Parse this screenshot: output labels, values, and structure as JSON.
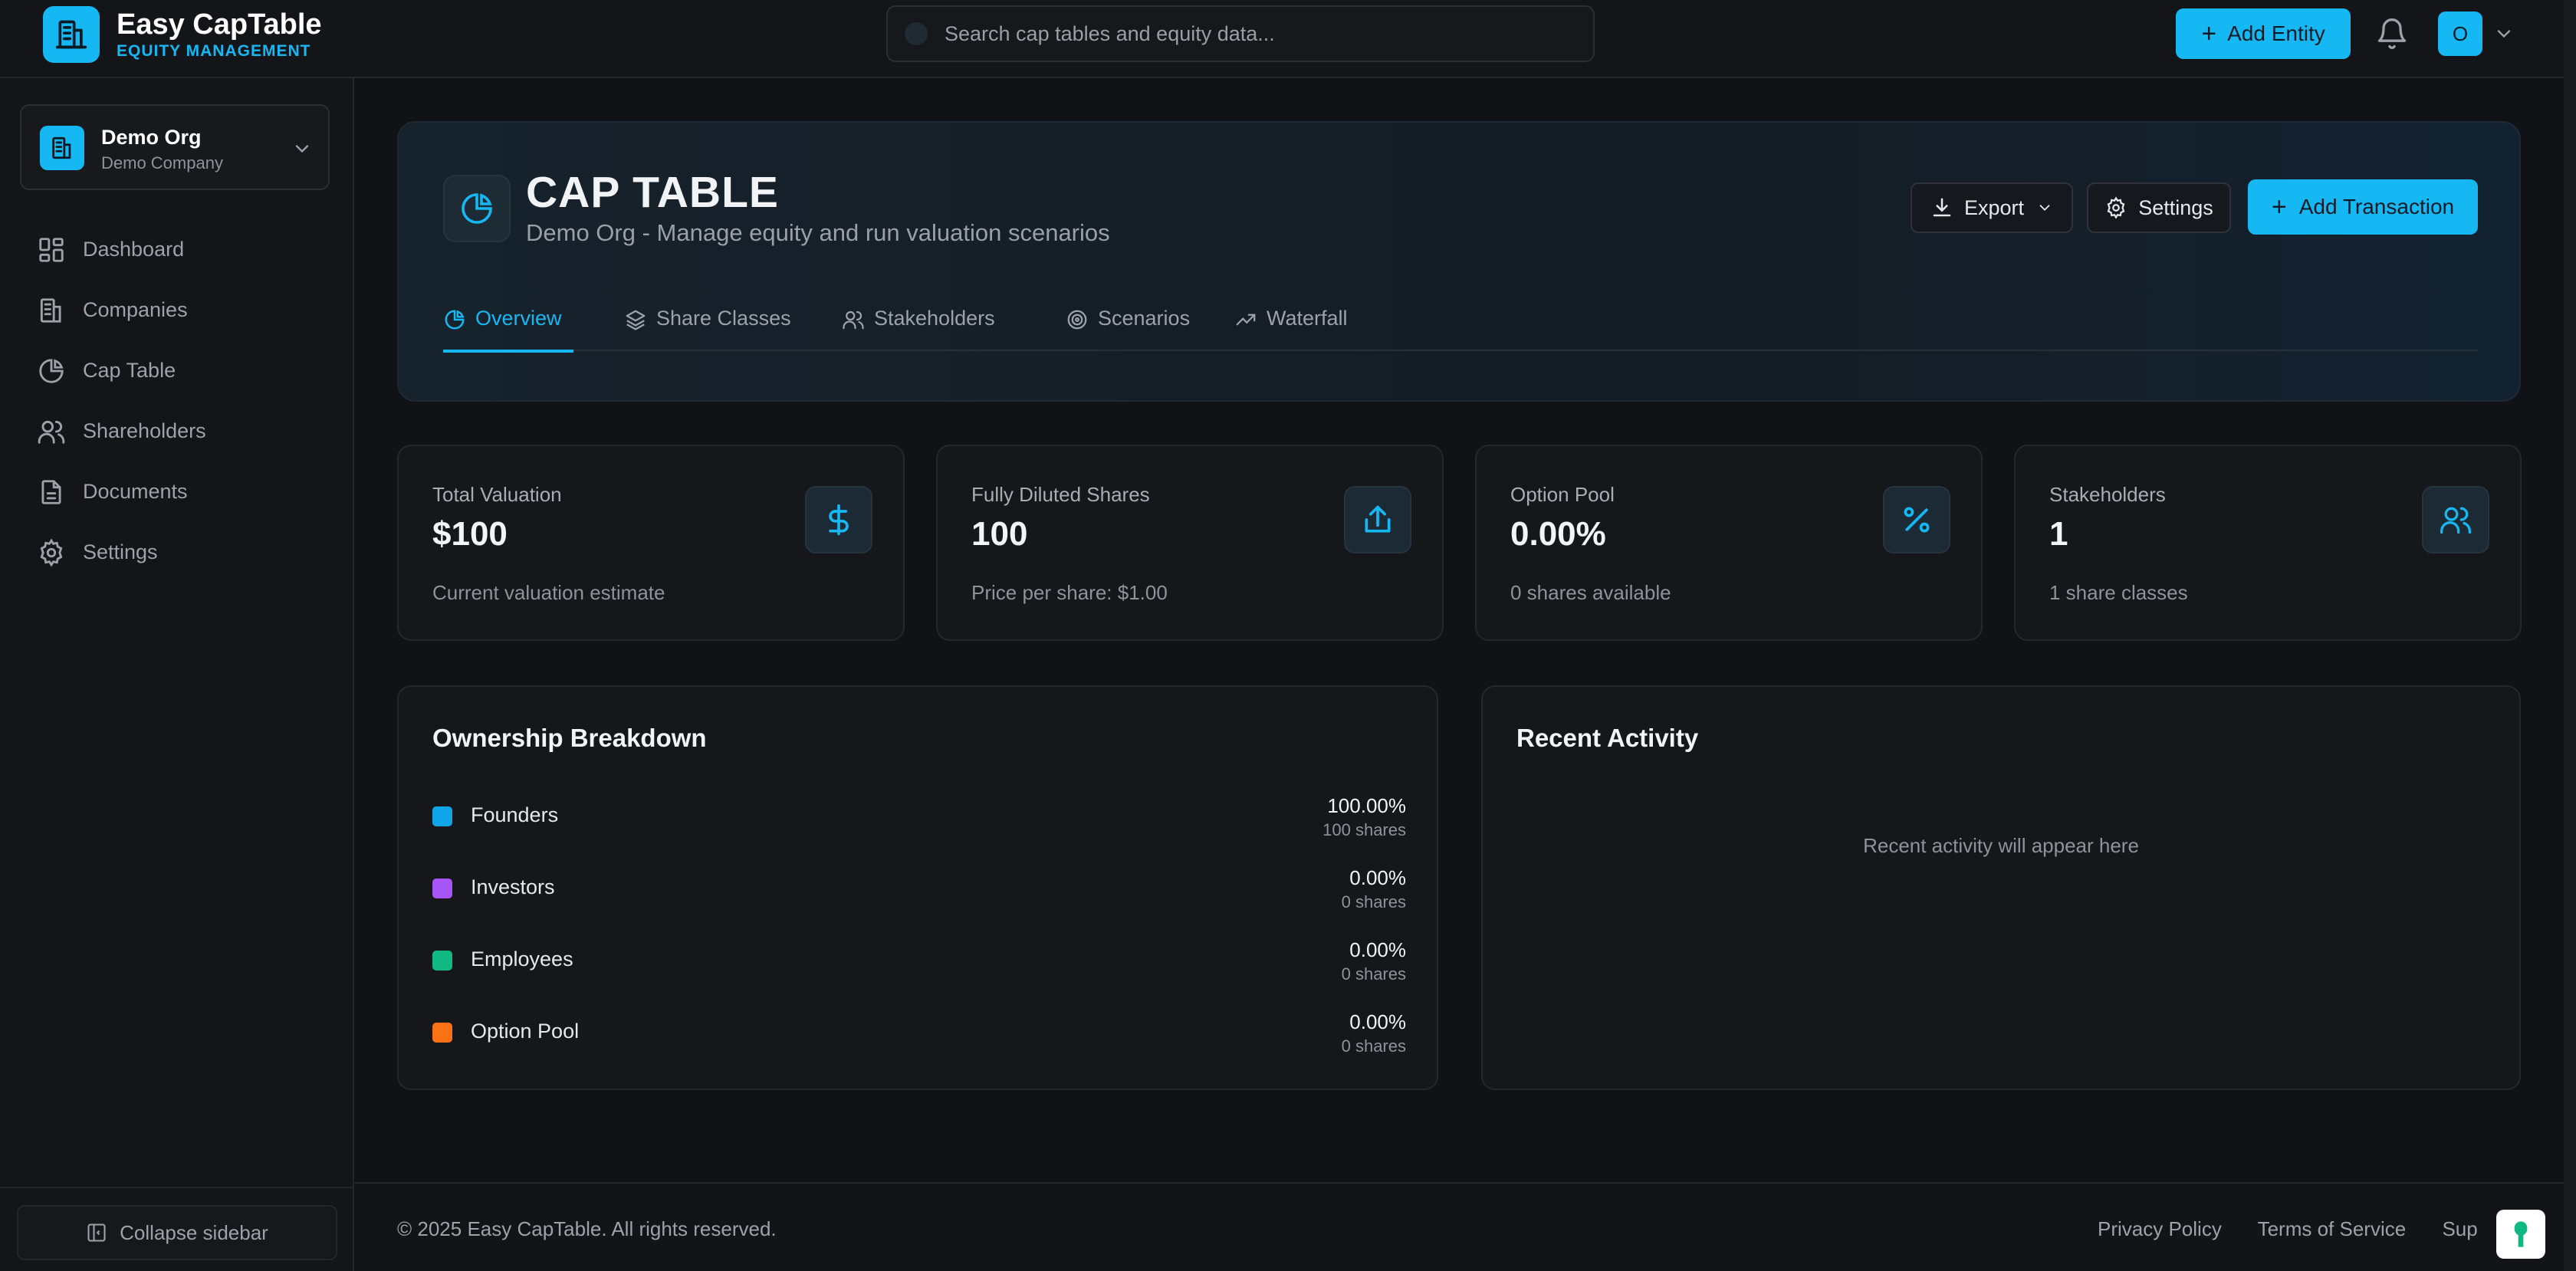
{
  "brand": {
    "name": "Easy CapTable",
    "subtitle": "EQUITY MANAGEMENT"
  },
  "search": {
    "placeholder": "Search cap tables and equity data..."
  },
  "header": {
    "add_entity_label": "Add Entity",
    "avatar_initial": "O"
  },
  "org": {
    "name": "Demo Org",
    "type": "Demo Company"
  },
  "sidebar": {
    "items": [
      {
        "label": "Dashboard",
        "icon": "dashboard-icon"
      },
      {
        "label": "Companies",
        "icon": "building-icon"
      },
      {
        "label": "Cap Table",
        "icon": "pie-chart-icon"
      },
      {
        "label": "Shareholders",
        "icon": "users-icon"
      },
      {
        "label": "Documents",
        "icon": "document-icon"
      },
      {
        "label": "Settings",
        "icon": "gear-icon"
      }
    ],
    "collapse_label": "Collapse sidebar"
  },
  "page": {
    "title": "CAP TABLE",
    "subtitle": "Demo Org - Manage equity and run valuation scenarios",
    "export_label": "Export",
    "settings_label": "Settings",
    "add_transaction_label": "Add Transaction",
    "tabs": [
      {
        "label": "Overview",
        "active": true
      },
      {
        "label": "Share Classes",
        "active": false
      },
      {
        "label": "Stakeholders",
        "active": false
      },
      {
        "label": "Scenarios",
        "active": false
      },
      {
        "label": "Waterfall",
        "active": false
      }
    ]
  },
  "stats": [
    {
      "label": "Total Valuation",
      "value": "$100",
      "desc": "Current valuation estimate",
      "icon": "dollar-icon"
    },
    {
      "label": "Fully Diluted Shares",
      "value": "100",
      "desc": "Price per share: $1.00",
      "icon": "share-icon"
    },
    {
      "label": "Option Pool",
      "value": "0.00%",
      "desc": "0 shares available",
      "icon": "percent-icon"
    },
    {
      "label": "Stakeholders",
      "value": "1",
      "desc": "1 share classes",
      "icon": "users-icon"
    }
  ],
  "ownership": {
    "title": "Ownership Breakdown",
    "rows": [
      {
        "name": "Founders",
        "pct": "100.00%",
        "shares": "100 shares",
        "color": "#0ea5e9"
      },
      {
        "name": "Investors",
        "pct": "0.00%",
        "shares": "0 shares",
        "color": "#a855f7"
      },
      {
        "name": "Employees",
        "pct": "0.00%",
        "shares": "0 shares",
        "color": "#10b981"
      },
      {
        "name": "Option Pool",
        "pct": "0.00%",
        "shares": "0 shares",
        "color": "#f97316"
      }
    ]
  },
  "activity": {
    "title": "Recent Activity",
    "empty": "Recent activity will appear here"
  },
  "footer": {
    "copyright": "© 2025 Easy CapTable. All rights reserved.",
    "links": [
      "Privacy Policy",
      "Terms of Service",
      "Sup"
    ]
  },
  "theme": {
    "accent": "#16b8f3",
    "background": "#111216"
  }
}
